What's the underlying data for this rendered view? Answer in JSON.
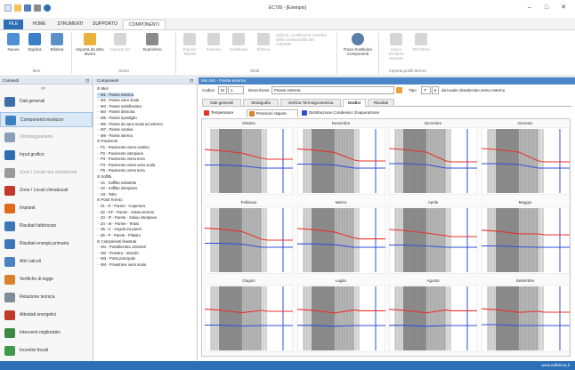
{
  "window": {
    "title": "EC700 - [Esempio]"
  },
  "tabs": [
    "FILE",
    "HOME",
    "STRUMENTI",
    "SUPPORTO",
    "COMPONENTI"
  ],
  "ribbon": {
    "buttons": [
      {
        "label": "Nuovo",
        "enabled": true,
        "color": "#4f8fd6"
      },
      {
        "label": "Duplica",
        "enabled": true,
        "color": "#3c7fc9"
      },
      {
        "label": "Elimina",
        "enabled": true,
        "color": "#5b8fc7"
      },
      {
        "label": "Importa da altro lavoro",
        "enabled": true,
        "color": "#e8b23b"
      },
      {
        "label": "Importa da",
        "enabled": false
      },
      {
        "label": "Scarichino",
        "enabled": true,
        "color": "#8a8a8a"
      },
      {
        "label": "Ripulire Tabelle",
        "enabled": false
      },
      {
        "label": "Inserisci",
        "enabled": false
      },
      {
        "label": "Sostituisci",
        "enabled": false
      },
      {
        "label": "Elimina",
        "enabled": false
      },
      {
        "label": "Utilizza i coefficienti correttivi della conducibilità dei materiali",
        "enabled": false
      },
      {
        "label": "Trova Sostituisci Componenti",
        "enabled": true,
        "color": "#5a7fa6"
      },
      {
        "label": "Abaco Strutture Importa",
        "enabled": false
      },
      {
        "label": "XM Infissi",
        "enabled": false
      }
    ],
    "groups": [
      "Muri",
      "Unisci",
      "Strati",
      "Importa profili termici"
    ]
  },
  "left_nav": {
    "header": "Comandi",
    "items": [
      {
        "label": "Dati generali",
        "color": "#3d6fa8",
        "active": false,
        "dim": false
      },
      {
        "label": "Componenti involucro",
        "color": "#3d7fc0",
        "active": true,
        "dim": false
      },
      {
        "label": "Ombreggiamenti",
        "color": "#8aa0b8",
        "active": false,
        "dim": true
      },
      {
        "label": "Input grafico",
        "color": "#2e6db0",
        "active": false,
        "dim": false
      },
      {
        "label": "Zone / Locali non climatizzati",
        "color": "#9a9a9a",
        "active": false,
        "dim": true
      },
      {
        "label": "Zone / Locali climatizzati",
        "color": "#c0392b",
        "active": false,
        "dim": false
      },
      {
        "label": "Impianti",
        "color": "#e06a1b",
        "active": false,
        "dim": false
      },
      {
        "label": "Risultati fabbricato",
        "color": "#3c78b8",
        "active": false,
        "dim": false
      },
      {
        "label": "Risultati energia primaria",
        "color": "#3c78b8",
        "active": false,
        "dim": false
      },
      {
        "label": "Altri calcoli",
        "color": "#4a83c0",
        "active": false,
        "dim": false
      },
      {
        "label": "Verifiche di legge",
        "color": "#d9822b",
        "active": false,
        "dim": false
      },
      {
        "label": "Relazione tecnica",
        "color": "#7f8c99",
        "active": false,
        "dim": false
      },
      {
        "label": "Attestati energetici",
        "color": "#c0392b",
        "active": false,
        "dim": false
      },
      {
        "label": "Interventi migliorativi",
        "color": "#3d8a47",
        "active": false,
        "dim": false
      },
      {
        "label": "Incentivi fiscali",
        "color": "#3f9a4c",
        "active": false,
        "dim": false
      }
    ]
  },
  "tree": {
    "header": "Componenti",
    "lines": [
      "⊟ Muri",
      "   ·· M1 - Parete esterna",
      "   ·· M2 - Parete vano scala",
      "   ·· M3 - Parete sottofinestra",
      "   ·· M4 - Parete divisoria",
      "   ·· M5 - Parete ripostiglio",
      "   ·· M6 - Parete da vano scala ad esterno",
      "   ·· M7 - Parete cantina",
      "   ·· M8 - Parete interna",
      "⊟ Pavimenti",
      "   ·· P1 - Pavimento verso cantina",
      "   ·· P2 - Pavimento interpiano",
      "   ·· P3 - Pavimento verso terra",
      "   ·· P4 - Pavimento verso vano scala",
      "   ·· P5 - Pavimento verso terra",
      "⊟ Soffitti",
      "   ·· S1 - Soffitto sottotetto",
      "   ·· S2 - Soffitto interpiano",
      "   ·· S3 - Tetto",
      "⊟ Ponti Termici",
      "   ·· Z1 - R - Parete - Copertura",
      "   ·· Z2 - GF - Parete - Solaio terreno",
      "   ·· Z3 - IF - Parete - Solaio interpiano",
      "   ·· Z4 - W - Parete - Telaio",
      "   ·· Z5 - C - Angolo tra pareti",
      "   ·· Z6 - P - Parete - Pilastro",
      "⊟ Componenti finestrati",
      "   ·· W1 - Portafinestra 120x240",
      "   ·· W2 - Finestra - 20x150",
      "   ·· W3 - Porta principale",
      "   ·· W4 - Finestrone vano scala"
    ]
  },
  "main": {
    "header": "Muri M1 - Parete esterna",
    "codice_label": "Codice",
    "codice_prefix": "M",
    "codice_value": "1",
    "descrizione_label": "Descrizione",
    "descrizione_value": "Parete esterna",
    "tipo_label": "Tipo",
    "tipo_value": "T",
    "tipo_text": "da locale climatizzato verso esterno",
    "subtabs": [
      "Dati generali",
      "Stratigrafia",
      "Verifica Termoigrometrica",
      "Grafici",
      "Risultati"
    ],
    "chart_tabs": [
      "Temperature",
      "Pressioni Vapore",
      "Distribuzione Condensa / Evaporazione"
    ],
    "months": [
      "Ottobre",
      "Novembre",
      "Dicembre",
      "Gennaio",
      "Febbraio",
      "Marzo",
      "Aprile",
      "Maggio",
      "Giugno",
      "Luglio",
      "Agosto",
      "Settembre"
    ]
  },
  "status": {
    "text": "www.edilclima.it"
  },
  "colors": {
    "accent": "#2b6fb6",
    "red_series": "#e8322b",
    "blue_series": "#2f4fd9"
  }
}
